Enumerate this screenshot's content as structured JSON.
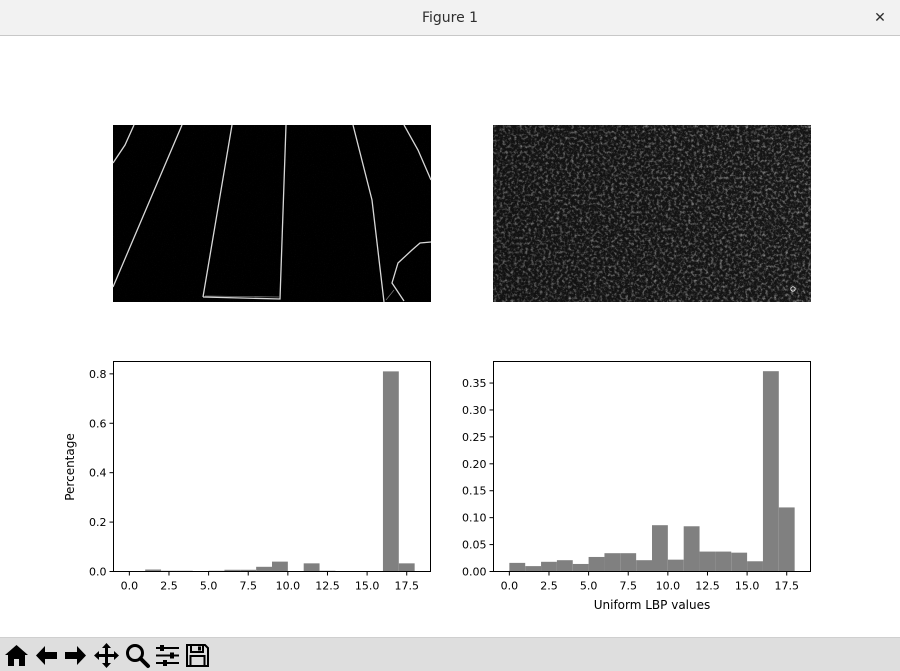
{
  "window": {
    "title": "Figure 1",
    "close_glyph": "✕"
  },
  "toolbar": {
    "buttons": [
      {
        "name": "home-icon",
        "tooltip": "Reset original view"
      },
      {
        "name": "back-arrow-icon",
        "tooltip": "Back"
      },
      {
        "name": "forward-arrow-icon",
        "tooltip": "Forward"
      },
      {
        "name": "pan-icon",
        "tooltip": "Pan"
      },
      {
        "name": "zoom-icon",
        "tooltip": "Zoom"
      },
      {
        "name": "configure-subplots-icon",
        "tooltip": "Configure subplots"
      },
      {
        "name": "save-icon",
        "tooltip": "Save"
      }
    ]
  },
  "images": [
    {
      "name": "edge-image",
      "description_icon": "image-panel"
    },
    {
      "name": "texture-image",
      "description_icon": "image-panel"
    }
  ],
  "chart_data": [
    {
      "type": "bar",
      "bar_color": "#808080",
      "xlim": [
        -1,
        19
      ],
      "ylim": [
        0,
        0.85
      ],
      "xticks": [
        0,
        2.5,
        5,
        7.5,
        10,
        12.5,
        15,
        17.5
      ],
      "xtick_labels": [
        "0.0",
        "2.5",
        "5.0",
        "7.5",
        "10.0",
        "12.5",
        "15.0",
        "17.5"
      ],
      "yticks": [
        0,
        0.2,
        0.4,
        0.6,
        0.8
      ],
      "ytick_labels": [
        "0.0",
        "0.2",
        "0.4",
        "0.6",
        "0.8"
      ],
      "ylabel": "Percentage",
      "xlabel": "",
      "bin_width": 1,
      "bins": [
        0,
        1,
        2,
        3,
        4,
        5,
        6,
        7,
        8,
        9,
        10,
        11,
        12,
        13,
        14,
        15,
        16,
        17
      ],
      "values": [
        0.002,
        0.008,
        0.003,
        0.003,
        0.001,
        0.003,
        0.007,
        0.007,
        0.019,
        0.04,
        0.002,
        0.033,
        0.003,
        0.002,
        0.001,
        0.001,
        0.81,
        0.033
      ]
    },
    {
      "type": "bar",
      "bar_color": "#808080",
      "xlim": [
        -1,
        19
      ],
      "ylim": [
        0,
        0.39
      ],
      "xticks": [
        0,
        2.5,
        5,
        7.5,
        10,
        12.5,
        15,
        17.5
      ],
      "xtick_labels": [
        "0.0",
        "2.5",
        "5.0",
        "7.5",
        "10.0",
        "12.5",
        "15.0",
        "17.5"
      ],
      "yticks": [
        0,
        0.05,
        0.1,
        0.15,
        0.2,
        0.25,
        0.3,
        0.35
      ],
      "ytick_labels": [
        "0.00",
        "0.05",
        "0.10",
        "0.15",
        "0.20",
        "0.25",
        "0.30",
        "0.35"
      ],
      "ylabel": "",
      "xlabel": "Uniform LBP values",
      "bin_width": 1,
      "bins": [
        0,
        1,
        2,
        3,
        4,
        5,
        6,
        7,
        8,
        9,
        10,
        11,
        12,
        13,
        14,
        15,
        16,
        17
      ],
      "values": [
        0.016,
        0.01,
        0.018,
        0.021,
        0.014,
        0.027,
        0.034,
        0.034,
        0.021,
        0.086,
        0.022,
        0.084,
        0.037,
        0.037,
        0.035,
        0.019,
        0.372,
        0.119
      ]
    }
  ]
}
